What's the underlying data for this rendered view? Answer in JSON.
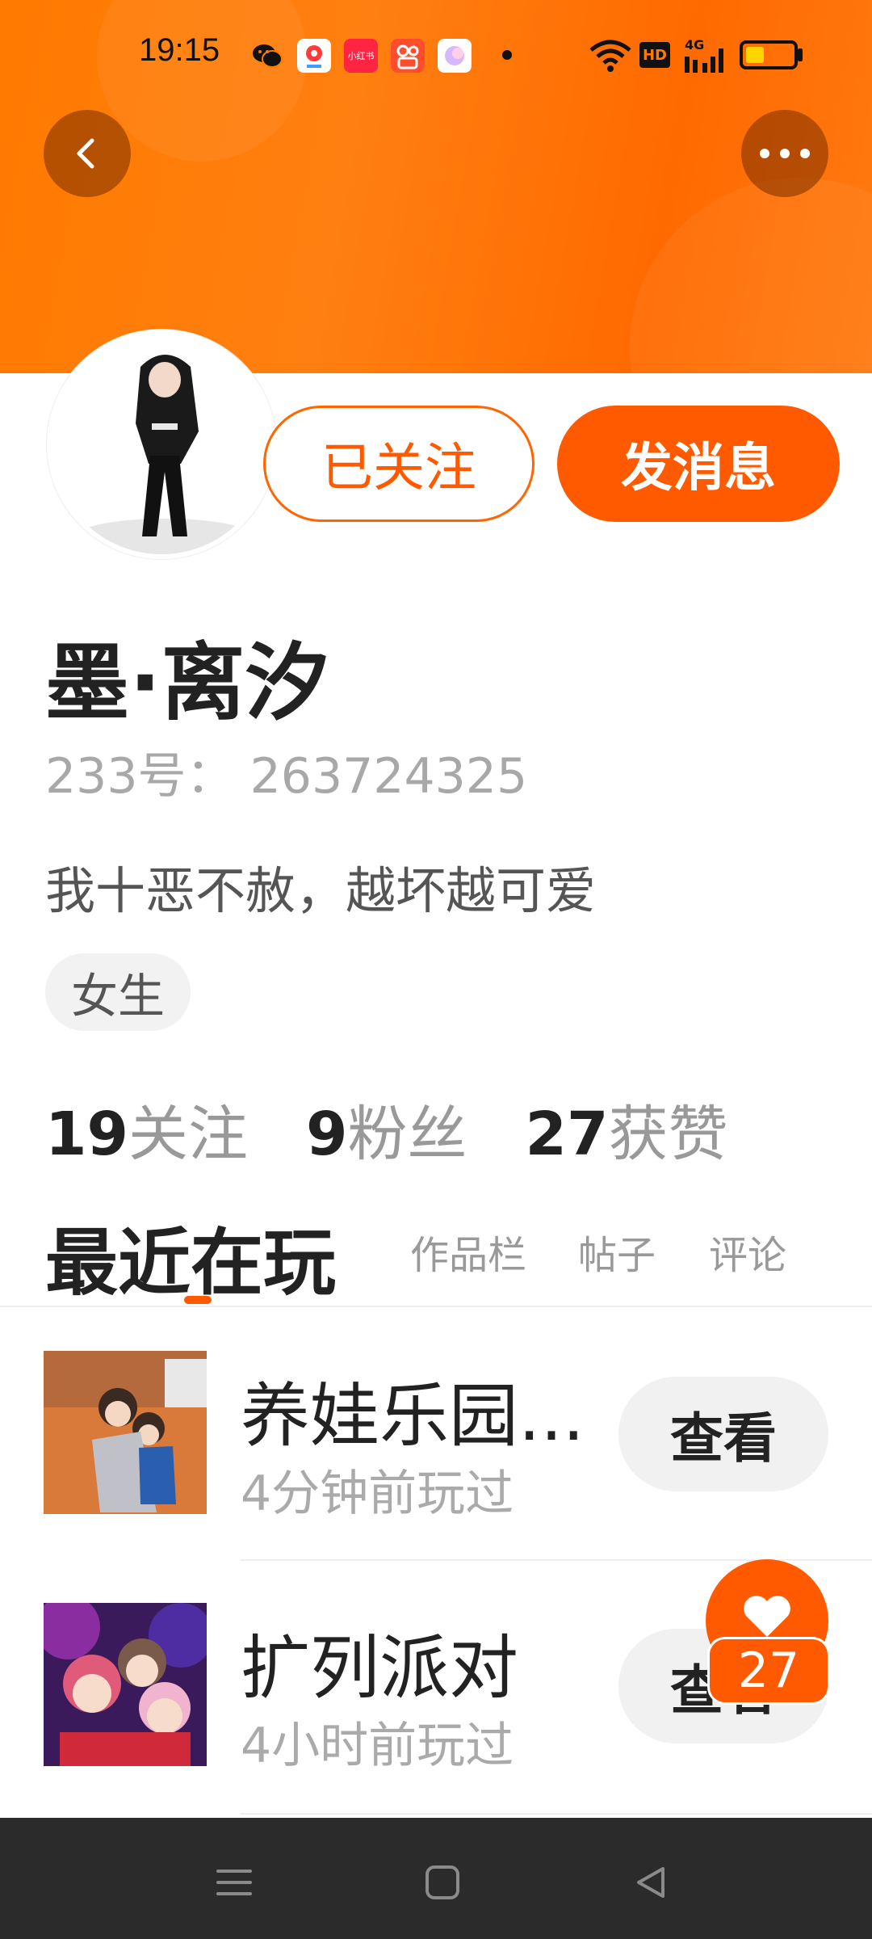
{
  "status_bar": {
    "time": "19:15",
    "notification_icons": [
      "wechat-icon",
      "map-app-icon",
      "xiaohongshu-icon",
      "kuaishou-icon",
      "gallery-app-icon"
    ],
    "notif_labels": {
      "xiaohongshu": "小红书"
    },
    "system_icons": [
      "wifi-icon",
      "hd-icon",
      "4g-signal-icon",
      "battery-icon"
    ],
    "hd_label": "HD",
    "network_label": "4G"
  },
  "header": {
    "back_icon": "chevron-left-icon",
    "more_icon": "more-dots-icon",
    "colors": {
      "gradient_start": "#ff7a00",
      "gradient_end": "#ff6a00"
    }
  },
  "profile": {
    "follow_button": "已关注",
    "message_button": "发消息",
    "name": "墨·离汐",
    "uid": "233号：  263724325",
    "bio": "我十恶不赦，越坏越可爱",
    "gender_tag": "女生",
    "stats": [
      {
        "num": "19",
        "label": "关注"
      },
      {
        "num": "9",
        "label": "粉丝"
      },
      {
        "num": "27",
        "label": "获赞"
      }
    ]
  },
  "tabs": {
    "active": "最近在玩",
    "items": [
      "作品栏",
      "帖子",
      "评论"
    ]
  },
  "games": [
    {
      "title": "养娃乐园...",
      "subtitle": "4分钟前玩过",
      "button": "查看"
    },
    {
      "title": "扩列派对",
      "subtitle": "4小时前玩过",
      "button": "查看"
    }
  ],
  "floating_like": {
    "icon": "heart-icon",
    "count": "27"
  },
  "navbar": {
    "icons": [
      "menu-icon",
      "home-square-icon",
      "back-triangle-icon"
    ]
  },
  "colors": {
    "accent": "#ff5a00",
    "navbar": "#2b2b2b"
  }
}
